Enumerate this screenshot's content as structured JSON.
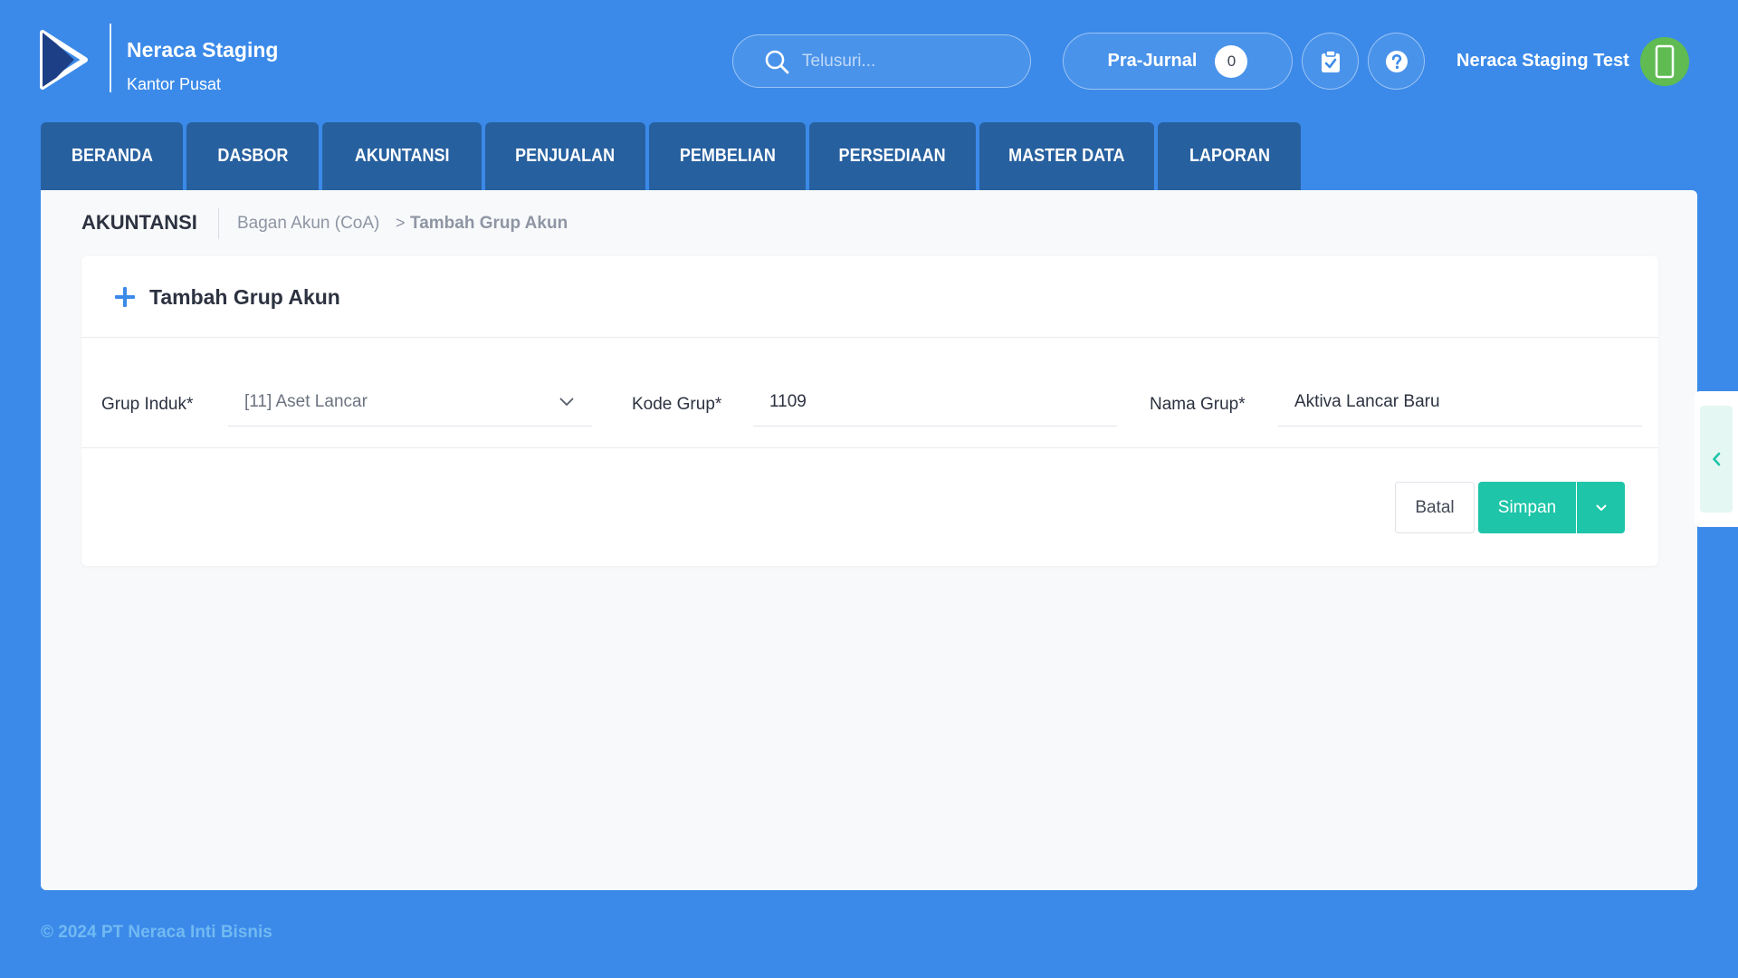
{
  "brand": {
    "name": "Neraca Staging",
    "office": "Kantor Pusat"
  },
  "header": {
    "search_placeholder": "Telusuri...",
    "prajurnal_label": "Pra-Jurnal",
    "prajurnal_count": "0",
    "user_name": "Neraca Staging Test"
  },
  "nav": {
    "tabs": [
      {
        "label": "BERANDA"
      },
      {
        "label": "DASBOR"
      },
      {
        "label": "AKUNTANSI"
      },
      {
        "label": "PENJUALAN"
      },
      {
        "label": "PEMBELIAN"
      },
      {
        "label": "PERSEDIAAN"
      },
      {
        "label": "MASTER DATA"
      },
      {
        "label": "LAPORAN"
      }
    ]
  },
  "breadcrumb": {
    "section": "AKUNTANSI",
    "parent": "Bagan Akun (CoA)",
    "separator": ">",
    "current": "Tambah Grup Akun"
  },
  "card": {
    "title": "Tambah Grup Akun"
  },
  "form": {
    "grup_induk_label": "Grup Induk*",
    "grup_induk_value": "[11] Aset Lancar",
    "kode_grup_label": "Kode Grup*",
    "kode_grup_value": "1109",
    "nama_grup_label": "Nama Grup*",
    "nama_grup_value": "Aktiva Lancar Baru"
  },
  "actions": {
    "cancel_label": "Batal",
    "save_label": "Simpan"
  },
  "footer": {
    "copyright": "© 2024 PT Neraca Inti Bisnis"
  },
  "colors": {
    "background": "#3b8ae9",
    "nav_tab": "#27609f",
    "primary_button": "#1ec5a8",
    "avatar": "#5fbb52",
    "plus_icon": "#3b8ae9"
  },
  "icons": {
    "logo": "play-logo-icon",
    "search": "search-icon",
    "clipboard": "clipboard-check-icon",
    "help": "question-circle-icon",
    "avatar": "mobile-phone-icon",
    "plus": "plus-icon",
    "dropdown": "chevron-down-icon",
    "side_tab": "chevron-left-icon"
  }
}
